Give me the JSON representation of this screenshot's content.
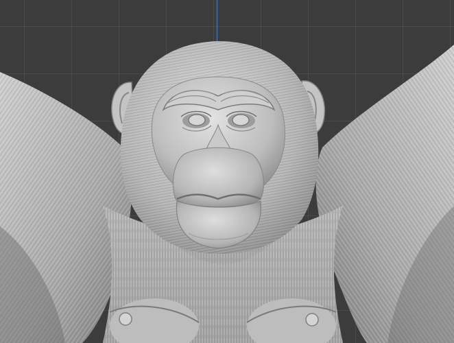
{
  "viewport": {
    "mode": "sculpt",
    "subject": "chimpanzee-bust",
    "grid": true,
    "colors": {
      "background": "#3c3c3c",
      "grid": "#4a4a4a",
      "axis_z": "#4f7fc4",
      "mesh": "#c8c8c8",
      "mesh_shadow": "#8a8a8a"
    }
  }
}
